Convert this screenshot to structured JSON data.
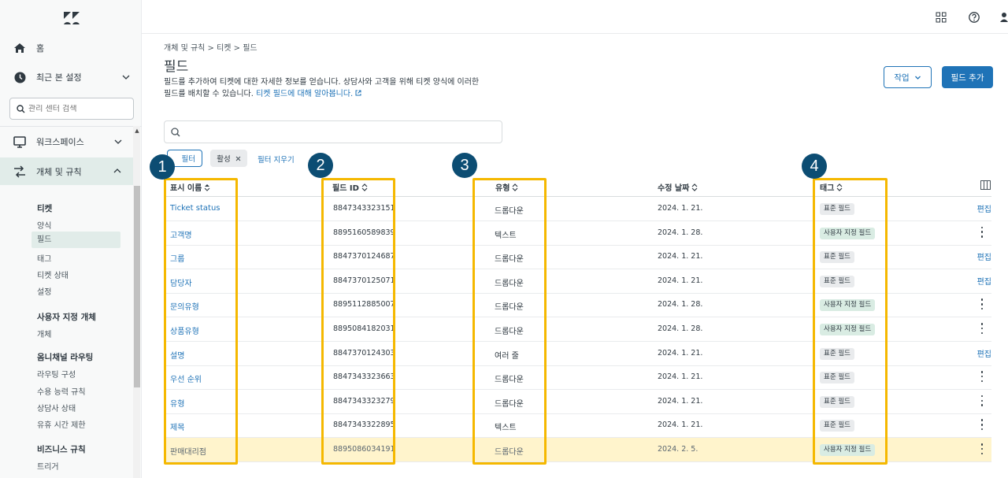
{
  "sidebar": {
    "home": "홈",
    "recent": "최근 본 설정",
    "search_placeholder": "관리 센터 검색",
    "workspace": "워크스페이스",
    "objects": "개체 및 규칙",
    "sections": [
      {
        "head": "티켓",
        "items": [
          "양식",
          "필드",
          "태그",
          "티켓 상태",
          "설정"
        ]
      },
      {
        "head": "사용자 지정 개체",
        "items": [
          "개체"
        ]
      },
      {
        "head": "옴니채널 라우팅",
        "items": [
          "라우팅 구성",
          "수용 능력 규칙",
          "상담사 상태",
          "유휴 시간 제한"
        ]
      },
      {
        "head": "비즈니스 규칙",
        "items": [
          "트리거"
        ]
      }
    ],
    "selected": "필드"
  },
  "breadcrumb": "개체 및 규칙 > 티켓 > 필드",
  "page_title": "필드",
  "description": "필드를 추가하여 티켓에 대한 자세한 정보를 얻습니다. 상담사와 고객을 위해 티켓 양식에 이러한 필드를 배치할 수 있습니다.",
  "description_link": "티켓 필드에 대해 알아봅니다.",
  "buttons": {
    "work": "작업",
    "add_field": "필드 추가",
    "filter": "필터",
    "clear": "필터 지우기"
  },
  "chip": "활성",
  "table": {
    "headers": {
      "name": "표시 이름",
      "id": "필드 ID",
      "type": "유형",
      "date": "수정 날짜",
      "tag": "태그"
    },
    "rows": [
      {
        "name": "Ticket status",
        "id": "8847343323151",
        "type": "드롭다운",
        "date": "2024. 1. 21.",
        "tag": "표준 필드",
        "action": "편집"
      },
      {
        "name": "고객명",
        "id": "8895160589839",
        "type": "텍스트",
        "date": "2024. 1. 28.",
        "tag": "사용자 지정 필드",
        "action": ""
      },
      {
        "name": "그룹",
        "id": "8847370124687",
        "type": "드롭다운",
        "date": "2024. 1. 21.",
        "tag": "표준 필드",
        "action": "편집"
      },
      {
        "name": "담당자",
        "id": "8847370125071",
        "type": "드롭다운",
        "date": "2024. 1. 21.",
        "tag": "표준 필드",
        "action": "편집"
      },
      {
        "name": "문의유형",
        "id": "8895112885007",
        "type": "드롭다운",
        "date": "2024. 1. 28.",
        "tag": "사용자 지정 필드",
        "action": ""
      },
      {
        "name": "상품유형",
        "id": "8895084182031",
        "type": "드롭다운",
        "date": "2024. 1. 28.",
        "tag": "사용자 지정 필드",
        "action": ""
      },
      {
        "name": "설명",
        "id": "8847370124303",
        "type": "여러 줄",
        "date": "2024. 1. 21.",
        "tag": "표준 필드",
        "action": "편집"
      },
      {
        "name": "우선 순위",
        "id": "8847343323663",
        "type": "드롭다운",
        "date": "2024. 1. 21.",
        "tag": "표준 필드",
        "action": ""
      },
      {
        "name": "유형",
        "id": "8847343323279",
        "type": "드롭다운",
        "date": "2024. 1. 21.",
        "tag": "표준 필드",
        "action": ""
      },
      {
        "name": "제목",
        "id": "8847343322895",
        "type": "텍스트",
        "date": "2024. 1. 21.",
        "tag": "표준 필드",
        "action": ""
      },
      {
        "name": "판매대리점",
        "id": "8895086034191",
        "type": "드롭다운",
        "date": "2024. 2. 5.",
        "tag": "사용자 지정 필드",
        "action": ""
      }
    ]
  },
  "annotations": [
    "1",
    "2",
    "3",
    "4"
  ],
  "colors": {
    "accent": "#1f73b7",
    "highlight": "#f5b800",
    "badge": "#0c4d73"
  }
}
